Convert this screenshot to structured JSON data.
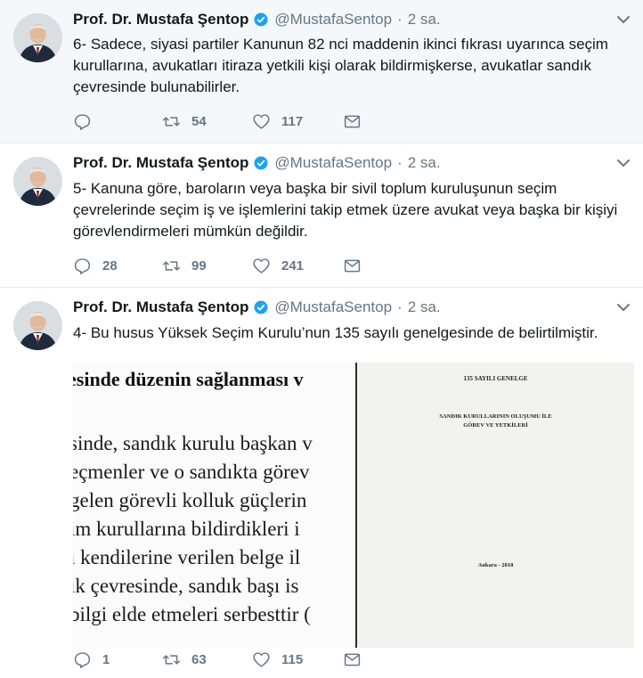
{
  "author": {
    "name": "Prof. Dr. Mustafa Şentop",
    "handle": "@MustafaSentop",
    "separator": "·",
    "time": "2 sa."
  },
  "tweets": [
    {
      "text": "6- Sadece, siyasi partiler Kanunun 82 nci maddenin ikinci fıkrası uyarınca seçim kurullarına, avukatları itiraza yetkili kişi olarak bildirmişkerse, avukatlar sandık çevresinde bulunabilirler.",
      "replies": "",
      "retweets": "54",
      "likes": "117"
    },
    {
      "text": "5- Kanuna göre, baroların veya başka bir sivil toplum kuruluşunun seçim çevrelerinde seçim iş ve işlemlerini takip etmek üzere avukat veya başka bir kişiyi görevlendirmeleri mümkün değildir.",
      "replies": "28",
      "retweets": "99",
      "likes": "241"
    },
    {
      "text": "4- Bu husus Yüksek Seçim Kurulu’nun 135 sayılı genelgesinde de belirtilmiştir.",
      "replies": "1",
      "retweets": "63",
      "likes": "115"
    }
  ],
  "document_excerpt": {
    "heading": "esinde düzenin sağlanması v",
    "lines": [
      "sinde, sandık kurulu başkan v",
      "eçmenler ve o sandıkta görev",
      "gelen görevli kolluk güçlerin",
      "im kurullarına bildirdikleri i",
      "ı kendilerine verilen belge il",
      "ık çevresinde, sandık başı is",
      " bilgi elde etmeleri serbesttir ("
    ]
  },
  "document_cover": {
    "title": "135 SAYILI GENELGE",
    "subtitle_1": "SANDIK KURULLARININ OLUŞUMU İLE",
    "subtitle_2": "GÖREV VE YETKİLERİ",
    "footer": "Ankara - 2018"
  },
  "colors": {
    "text": "#14171a",
    "muted": "#657786",
    "verified": "#1da1f2",
    "highlight_bg": "#f5f8fa"
  }
}
